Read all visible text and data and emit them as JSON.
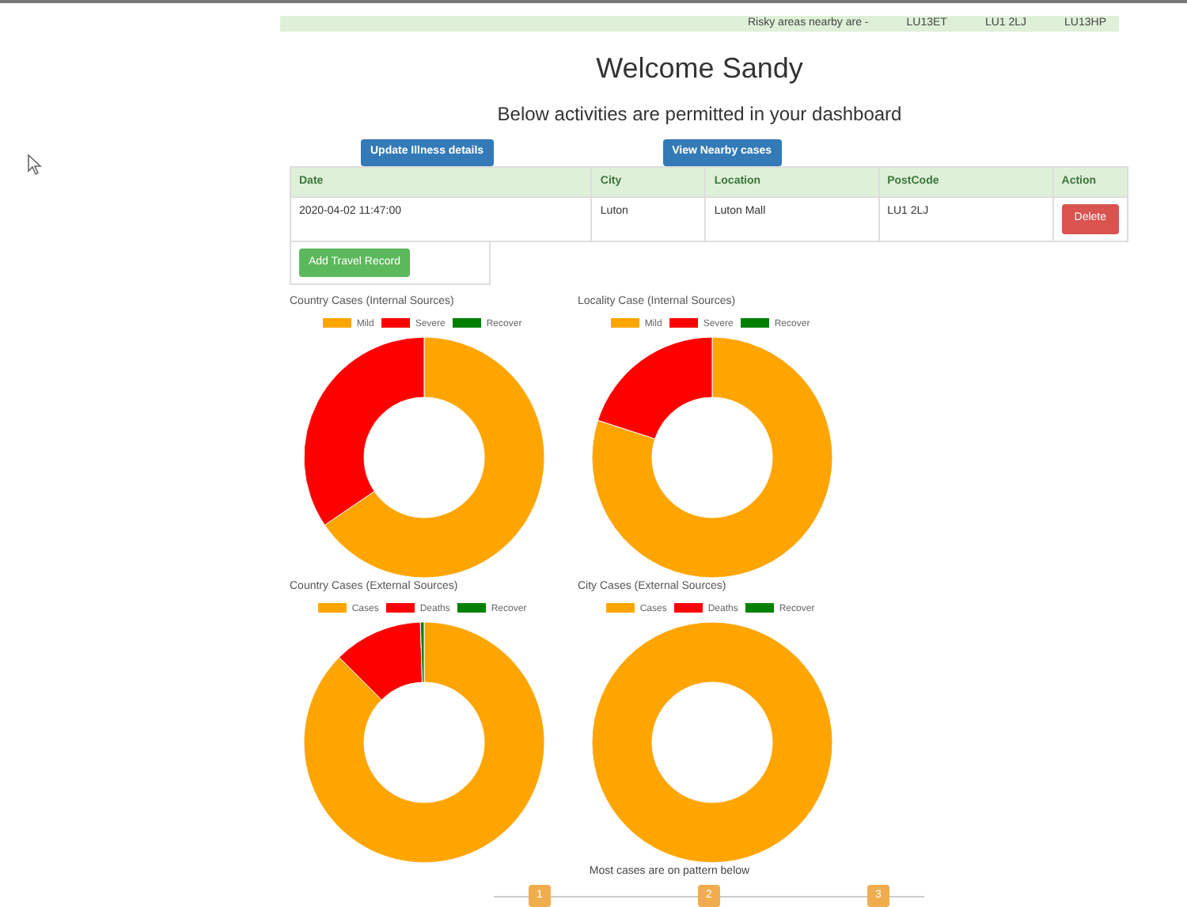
{
  "risk_bar": {
    "label": "Risky areas nearby are -",
    "areas": [
      "LU13ET",
      "LU1 2LJ",
      "LU13HP"
    ]
  },
  "heading": "Welcome Sandy",
  "subheading": "Below activities are permitted in your dashboard",
  "actions": [
    "Update Illness details",
    "View Nearby cases"
  ],
  "travel_table": {
    "columns": [
      "Date",
      "City",
      "Location",
      "PostCode",
      "Action"
    ],
    "rows": [
      {
        "date": "2020-04-02 11:47:00",
        "city": "Luton",
        "location": "Luton Mall",
        "postcode": "LU1 2LJ",
        "action": "Delete"
      }
    ],
    "add_button": "Add Travel Record"
  },
  "charts": [
    {
      "title": "Country Cases (Internal Sources)",
      "legend": [
        {
          "label": "Mild",
          "color": "#ffa500"
        },
        {
          "label": "Severe",
          "color": "#ff0000"
        },
        {
          "label": "Recover",
          "color": "#008000"
        }
      ]
    },
    {
      "title": "Locality Case (Internal Sources)",
      "legend": [
        {
          "label": "Mild",
          "color": "#ffa500"
        },
        {
          "label": "Severe",
          "color": "#ff0000"
        },
        {
          "label": "Recover",
          "color": "#008000"
        }
      ]
    },
    {
      "title": "Country Cases (External Sources)",
      "legend": [
        {
          "label": "Cases",
          "color": "#ffa500"
        },
        {
          "label": "Deaths",
          "color": "#ff0000"
        },
        {
          "label": "Recover",
          "color": "#008000"
        }
      ]
    },
    {
      "title": "City Cases (External Sources)",
      "legend": [
        {
          "label": "Cases",
          "color": "#ffa500"
        },
        {
          "label": "Deaths",
          "color": "#ff0000"
        },
        {
          "label": "Recover",
          "color": "#008000"
        }
      ]
    }
  ],
  "pattern": {
    "caption": "Most cases are on pattern below",
    "steps": [
      "1",
      "2",
      "3"
    ]
  }
}
